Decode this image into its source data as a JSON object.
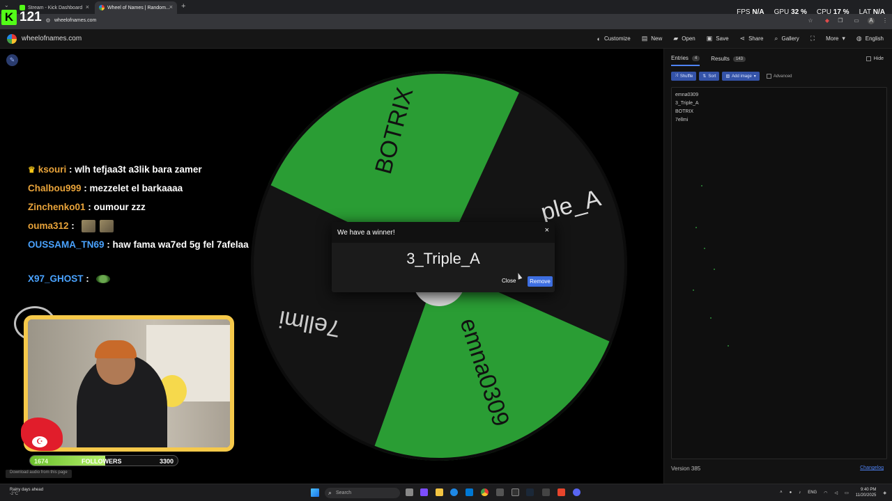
{
  "browser": {
    "tabs": [
      {
        "label": "Stream - Kick Dashboard",
        "favicon_color": "#53fc18"
      },
      {
        "label": "Wheel of Names | Random...",
        "favicon_color": "#1e88e5"
      }
    ],
    "new_tab": "+",
    "url": "wheelofnames.com"
  },
  "kick_overlay": {
    "logo": "K",
    "viewer_count": "121"
  },
  "perf": {
    "fps_label": "FPS",
    "fps_value": "N/A",
    "gpu_label": "GPU",
    "gpu_value": "32 %",
    "cpu_label": "CPU",
    "cpu_value": "17 %",
    "lat_label": "LAT",
    "lat_value": "N/A"
  },
  "site": {
    "title": "wheelofnames.com",
    "menu": [
      "Customize",
      "New",
      "Open",
      "Save",
      "Share",
      "Gallery",
      "More",
      "English"
    ]
  },
  "wheel": {
    "colors": {
      "green": "#2a9d34",
      "dark": "#141414"
    },
    "slices": [
      "BOTRIX",
      "3_Triple_A",
      "emna0309",
      "7ellmi"
    ],
    "visible_label_fragment": "ple_A"
  },
  "dialog": {
    "title": "We have a winner!",
    "close_icon": "×",
    "winner": "3_Triple_A",
    "close_label": "Close",
    "remove_label": "Remove"
  },
  "chat": [
    {
      "user": "ksouri",
      "text": "wlh tefjaa3t a3lik bara zamer",
      "badge": "crown-icon"
    },
    {
      "user": "Chalbou999",
      "text": "mezzelet el barkaaaa"
    },
    {
      "user": "Zinchenko01",
      "text": "oumour zzz"
    },
    {
      "user": "ouma312",
      "text": "",
      "emotes": 2
    },
    {
      "user": "OUSSAMA_TN69",
      "text": "haw fama wa7ed 5g fel 7afelaa"
    },
    {
      "user": "X97_GHOST",
      "text": "",
      "emotes": 1
    }
  ],
  "followers": {
    "current": "1674",
    "label": "FOLLOWERS",
    "goal": "3300",
    "progress": 0.51
  },
  "download_tip": "Download audio from this page",
  "panel": {
    "tabs": [
      {
        "label": "Entries",
        "count": "4"
      },
      {
        "label": "Results",
        "count": "143"
      }
    ],
    "hide_label": "Hide",
    "toolbar": {
      "shuffle": "Shuffle",
      "sort": "Sort",
      "add_image": "Add image",
      "advanced": "Advanced"
    },
    "entries": [
      "emna0309",
      "3_Triple_A",
      "BOTRIX",
      "7ellmi"
    ],
    "version": "Version 385",
    "changelog": "Changelog"
  },
  "taskbar": {
    "weather_title": "Rainy days ahead",
    "weather_temp": "-2°C",
    "search_placeholder": "Search",
    "lang": "ENG",
    "time": "9:40 PM",
    "date": "11/20/2025"
  }
}
